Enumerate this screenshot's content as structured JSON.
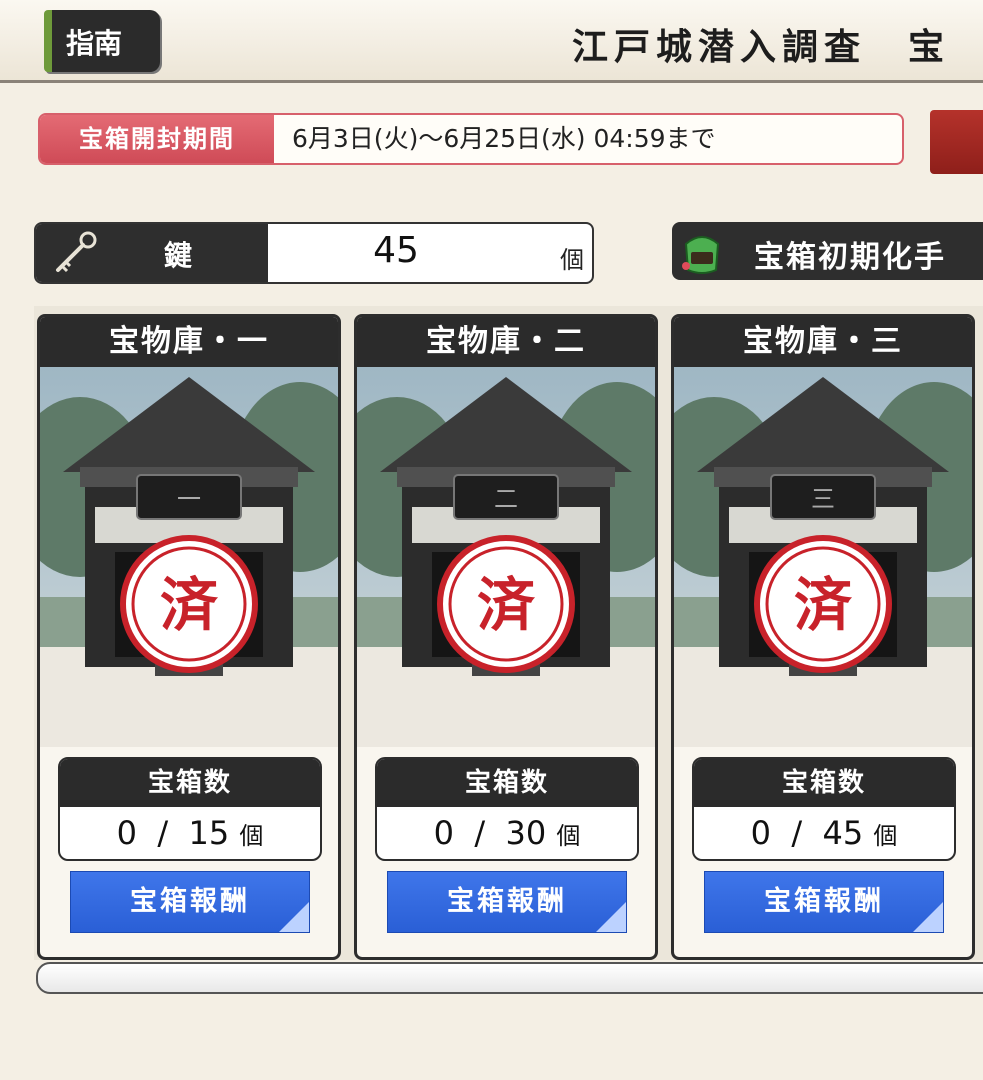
{
  "header": {
    "guide_label": "指南",
    "title": "江戸城潜入調査　宝"
  },
  "period": {
    "label": "宝箱開封期間",
    "value": "6月3日(火)〜6月25日(水) 04:59まで"
  },
  "keys": {
    "label": "鍵",
    "count": "45",
    "unit": "個"
  },
  "reset": {
    "label": "宝箱初期化手"
  },
  "vaults": [
    {
      "title": "宝物庫・一",
      "plaque": "一",
      "stamp": "済",
      "count_title": "宝箱数",
      "opened": "0",
      "sep": "/",
      "total": "15",
      "unit": "個",
      "reward_label": "宝箱報酬"
    },
    {
      "title": "宝物庫・二",
      "plaque": "二",
      "stamp": "済",
      "count_title": "宝箱数",
      "opened": "0",
      "sep": "/",
      "total": "30",
      "unit": "個",
      "reward_label": "宝箱報酬"
    },
    {
      "title": "宝物庫・三",
      "plaque": "三",
      "stamp": "済",
      "count_title": "宝箱数",
      "opened": "0",
      "sep": "/",
      "total": "45",
      "unit": "個",
      "reward_label": "宝箱報酬"
    }
  ],
  "colors": {
    "accent_red": "#cf4b57",
    "reward_blue": "#2a5fd6",
    "stamp_red": "#c8222a",
    "panel_dark": "#2b2b2b",
    "background": "#f4efe4"
  }
}
